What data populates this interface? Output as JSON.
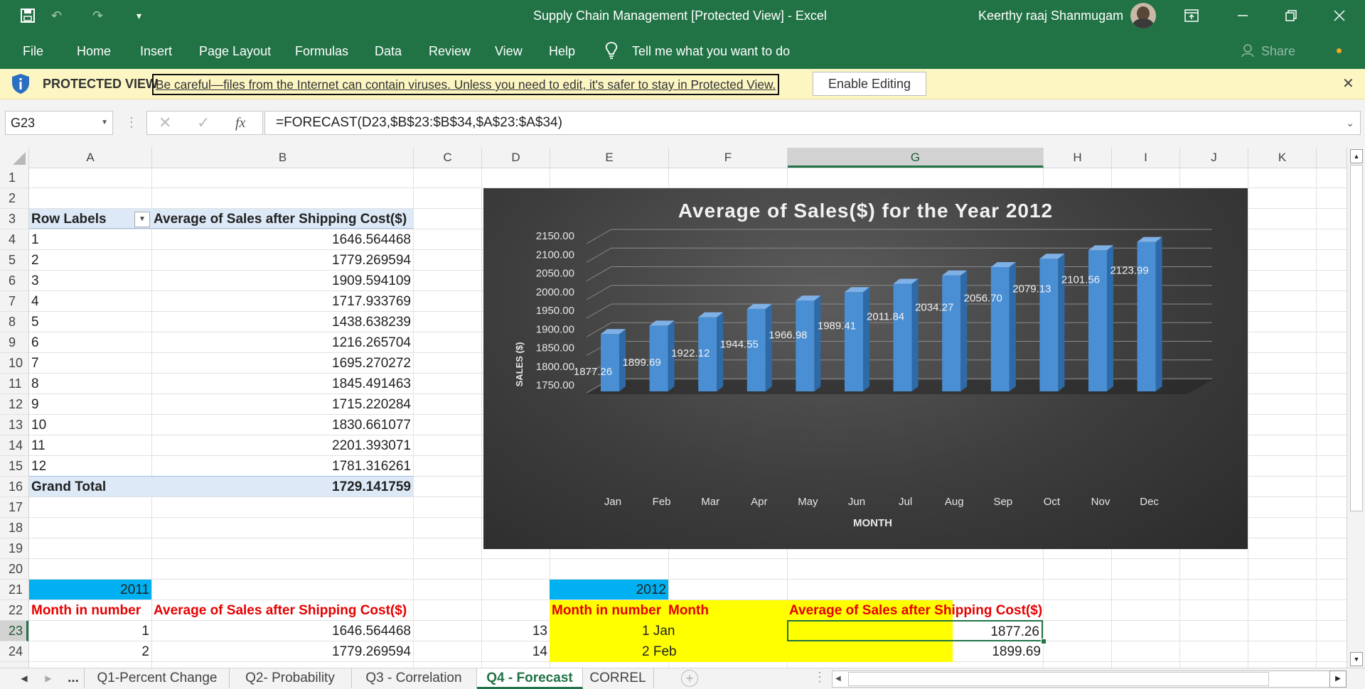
{
  "titlebar": {
    "doc_title": "Supply Chain Management  [Protected View]  -  Excel",
    "user": "Keerthy raaj Shanmugam",
    "qat_customize": "▾"
  },
  "ribbon": {
    "tabs": [
      "File",
      "Home",
      "Insert",
      "Page Layout",
      "Formulas",
      "Data",
      "Review",
      "View",
      "Help"
    ],
    "tell_me": "Tell me what you want to do",
    "share": "Share"
  },
  "protected_view": {
    "label": "PROTECTED VIEW",
    "message": "Be careful—files from the Internet can contain viruses. Unless you need to edit, it's safer to stay in Protected View.",
    "enable_button": "Enable Editing"
  },
  "formula_bar": {
    "name_box": "G23",
    "fx": "fx",
    "formula": "=FORECAST(D23,$B$23:$B$34,$A$23:$A$34)"
  },
  "columns": [
    "A",
    "B",
    "C",
    "D",
    "E",
    "F",
    "G",
    "H",
    "I",
    "J",
    "K"
  ],
  "rows": [
    "1",
    "2",
    "3",
    "4",
    "5",
    "6",
    "7",
    "8",
    "9",
    "10",
    "11",
    "12",
    "13",
    "14",
    "15",
    "16",
    "17",
    "18",
    "19",
    "20",
    "21",
    "22",
    "23",
    "24"
  ],
  "pivot": {
    "header_label": "Row Labels",
    "header_value": "Average of Sales after Shipping Cost($)",
    "labels": [
      "1",
      "2",
      "3",
      "4",
      "5",
      "6",
      "7",
      "8",
      "9",
      "10",
      "11",
      "12"
    ],
    "values": [
      "1646.564468",
      "1779.269594",
      "1909.594109",
      "1717.933769",
      "1438.638239",
      "1216.265704",
      "1695.270272",
      "1845.491463",
      "1715.220284",
      "1830.661077",
      "2201.393071",
      "1781.316261"
    ],
    "grand_total_label": "Grand Total",
    "grand_total_value": "1729.141759"
  },
  "table2011": {
    "year": "2011",
    "col1": "Month in number",
    "col2": "Average of Sales after Shipping Cost($)",
    "rows": [
      [
        "1",
        "1646.564468"
      ],
      [
        "2",
        "1779.269594"
      ]
    ]
  },
  "table2012": {
    "year": "2012",
    "col_d_values": [
      "13",
      "14"
    ],
    "col1": "Month in number",
    "col2": "Month",
    "col3": "Average of Sales after Shipping Cost($)",
    "rows": [
      [
        "1 Jan",
        "1877.26"
      ],
      [
        "2 Feb",
        "1899.69"
      ]
    ]
  },
  "chart_data": {
    "type": "bar",
    "title": "Average of Sales($) for the Year 2012",
    "xlabel": "MONTH",
    "ylabel": "SALES ($)",
    "ylim": [
      1750,
      2150
    ],
    "yticks": [
      "2150.00",
      "2100.00",
      "2050.00",
      "2000.00",
      "1950.00",
      "1900.00",
      "1850.00",
      "1800.00",
      "1750.00"
    ],
    "categories": [
      "Jan",
      "Feb",
      "Mar",
      "Apr",
      "May",
      "Jun",
      "Jul",
      "Aug",
      "Sep",
      "Oct",
      "Nov",
      "Dec"
    ],
    "values": [
      1877.26,
      1899.69,
      1922.12,
      1944.55,
      1966.98,
      1989.41,
      2011.84,
      2034.27,
      2056.7,
      2079.13,
      2101.56,
      2123.99
    ],
    "labels": [
      "1877.26",
      "1899.69",
      "1922.12",
      "1944.55",
      "1966.98",
      "1989.41",
      "2011.84",
      "2034.27",
      "2056.70",
      "2079.13",
      "2101.56",
      "2123.99"
    ],
    "bar_color": "#4a8fd4",
    "grid": true
  },
  "sheet_tabs": [
    "Q1-Percent Change",
    "Q2- Probability",
    "Q3 - Correlation",
    "Q4 - Forecast",
    "CORREL"
  ],
  "active_tab": "Q4 - Forecast",
  "tab_more": "..."
}
